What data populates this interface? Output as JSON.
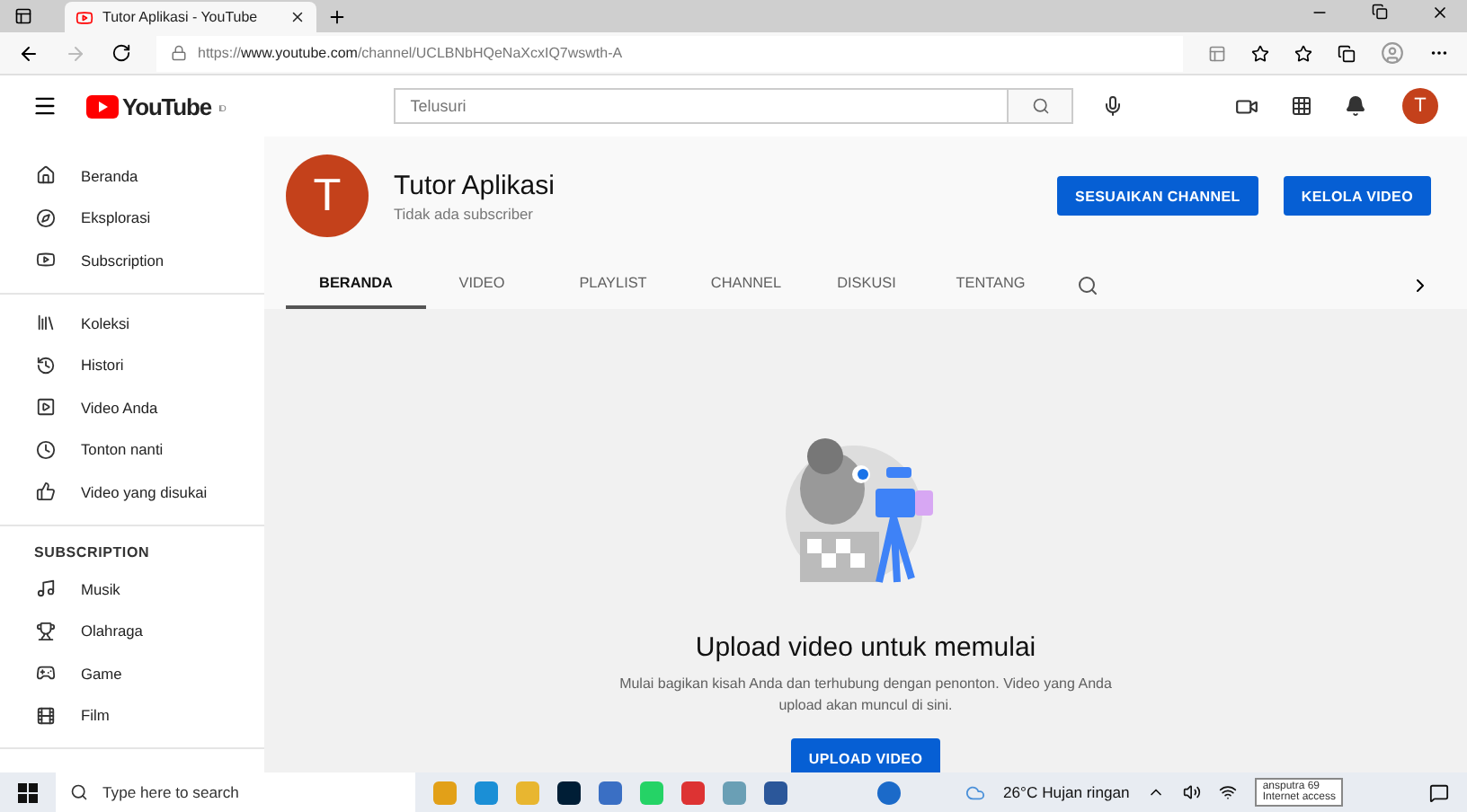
{
  "browser": {
    "tab_title": "Tutor Aplikasi - YouTube",
    "url_prefix": "https://",
    "url_domain": "www.youtube.com",
    "url_path": "/channel/UCLBNbHQeNaXcxIQ7wswth-A"
  },
  "header": {
    "logo_text": "YouTube",
    "region": "ID",
    "search": {
      "placeholder": "Telusuri"
    },
    "avatar_letter": "T"
  },
  "sidebar": {
    "sections": [
      {
        "items": [
          {
            "label": "Beranda",
            "selected": false
          },
          {
            "label": "Eksplorasi",
            "selected": false
          },
          {
            "label": "Subscription",
            "selected": false
          }
        ]
      },
      {
        "items": [
          {
            "label": "Koleksi",
            "selected": false
          },
          {
            "label": "Histori",
            "selected": false
          },
          {
            "label": "Video Anda",
            "selected": false
          },
          {
            "label": "Tonton nanti",
            "selected": false
          },
          {
            "label": "Video yang disukai",
            "selected": false
          }
        ]
      },
      {
        "heading": "SUBSCRIPTION",
        "items": [
          {
            "label": "Musik",
            "selected": false
          },
          {
            "label": "Olahraga",
            "selected": false
          },
          {
            "label": "Game",
            "selected": false
          },
          {
            "label": "Film",
            "selected": false
          }
        ]
      }
    ]
  },
  "channel": {
    "avatar_letter": "T",
    "name": "Tutor Aplikasi",
    "subscribers": "Tidak ada subscriber",
    "buttons": [
      "SESUAIKAN CHANNEL",
      "KELOLA VIDEO"
    ],
    "tabs": [
      {
        "label": "BERANDA",
        "selected": true
      },
      {
        "label": "VIDEO",
        "selected": false
      },
      {
        "label": "PLAYLIST",
        "selected": false
      },
      {
        "label": "CHANNEL",
        "selected": false
      },
      {
        "label": "DISKUSI",
        "selected": false
      },
      {
        "label": "TENTANG",
        "selected": false
      }
    ]
  },
  "empty_state": {
    "title": "Upload video untuk memulai",
    "description": "Mulai bagikan kisah Anda dan terhubung dengan penonton. Video yang Anda upload akan muncul di sini.",
    "button": "UPLOAD VIDEO"
  },
  "taskbar": {
    "search": {
      "placeholder": "Type here to search"
    },
    "weather": "26°C Hujan ringan",
    "tooltip": [
      "ansputra 69",
      "Internet access"
    ]
  }
}
